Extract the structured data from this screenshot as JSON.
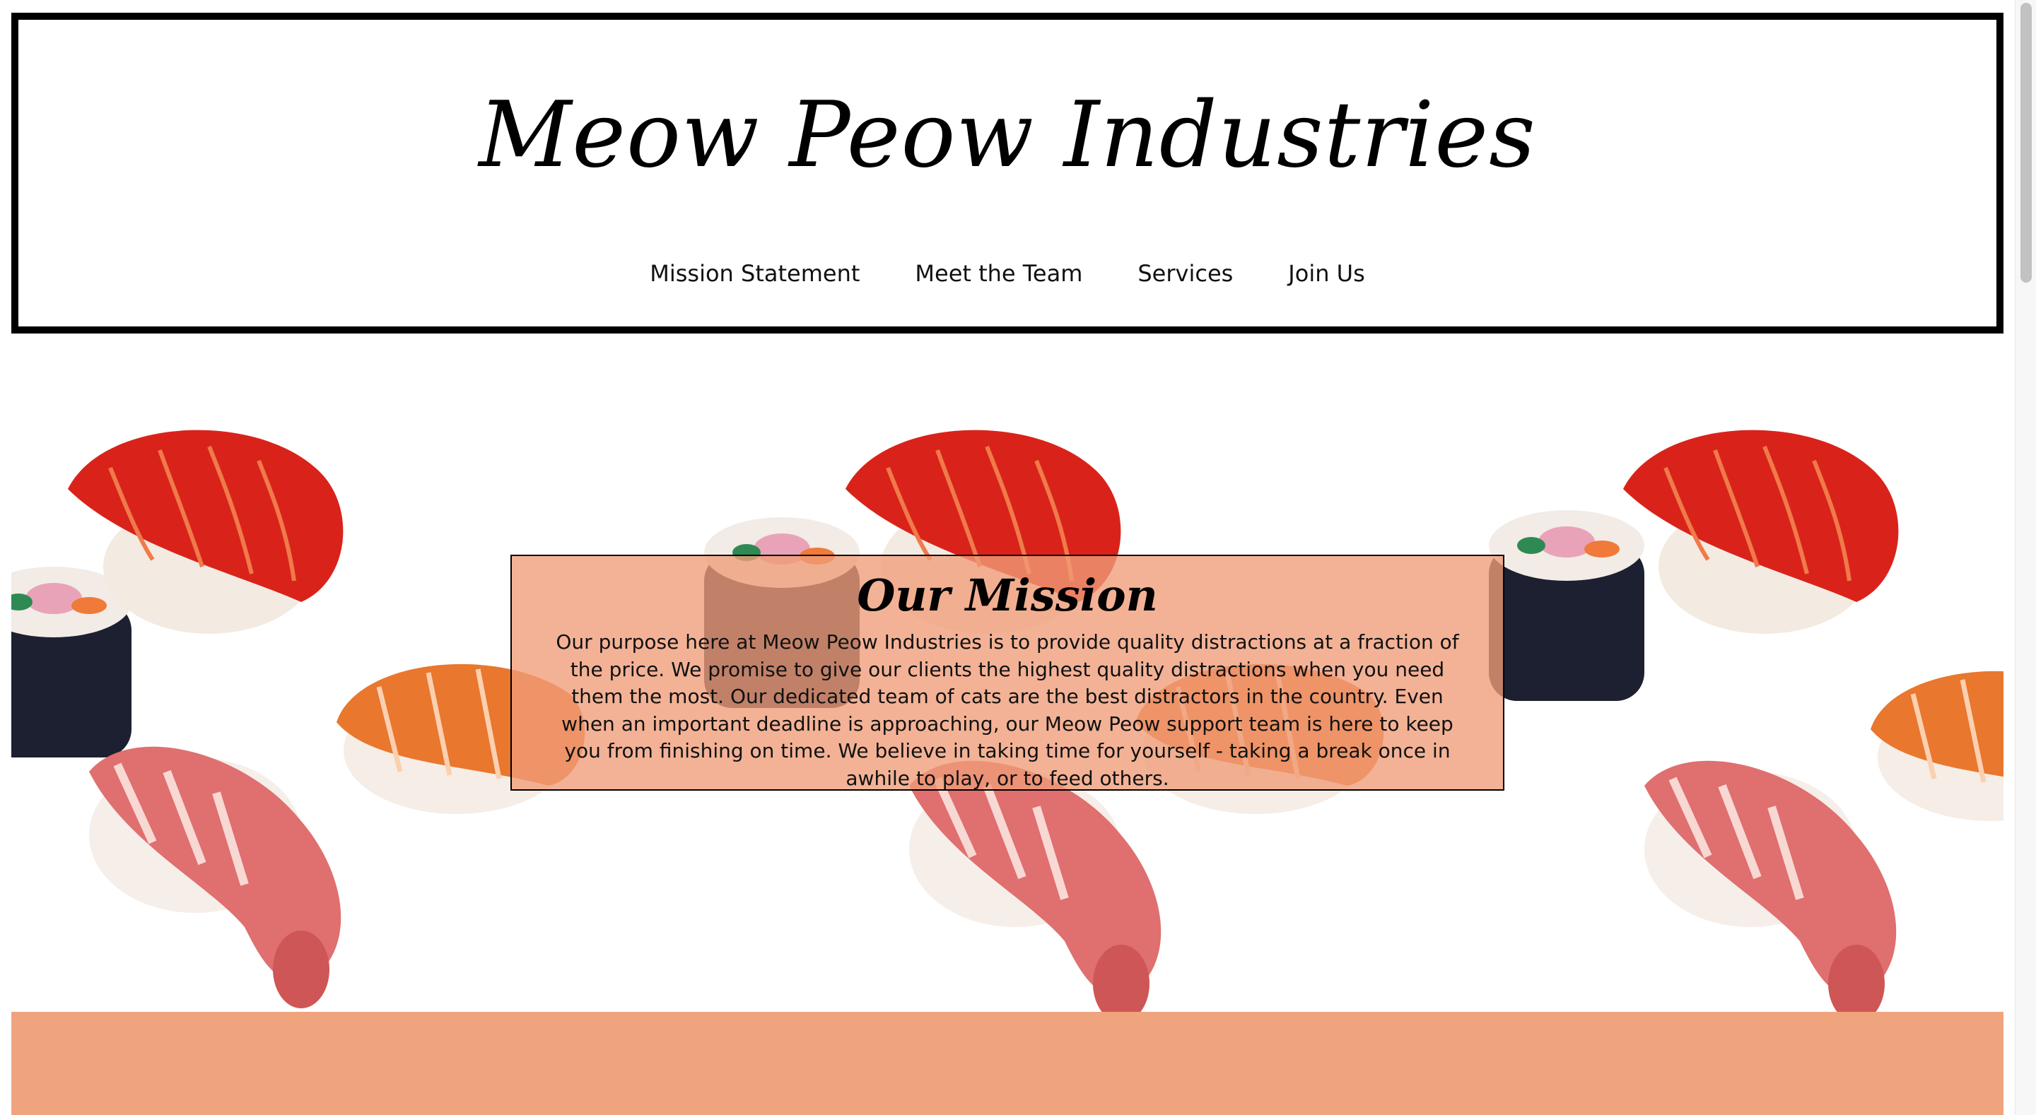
{
  "header": {
    "brand_title": "Meow Peow Industries",
    "nav_items": [
      {
        "label": "Mission Statement"
      },
      {
        "label": "Meet the Team"
      },
      {
        "label": "Services"
      },
      {
        "label": "Join Us"
      }
    ]
  },
  "mission": {
    "title": "Our Mission",
    "body": "Our purpose here at Meow Peow Industries is to provide quality distractions at a fraction of the price. We promise to give our clients the highest quality distractions when you need them the most. Our dedicated team of cats are the best distractors in the country. Even when an important deadline is approaching, our Meow Peow support team is here to keep you from finishing on time. We believe in taking time for yourself - taking a break once in awhile to play, or to feed others."
  },
  "colors": {
    "accent_salmon": "#f0a47d",
    "mission_box_bg": "#f09c78",
    "header_border": "#000000"
  }
}
